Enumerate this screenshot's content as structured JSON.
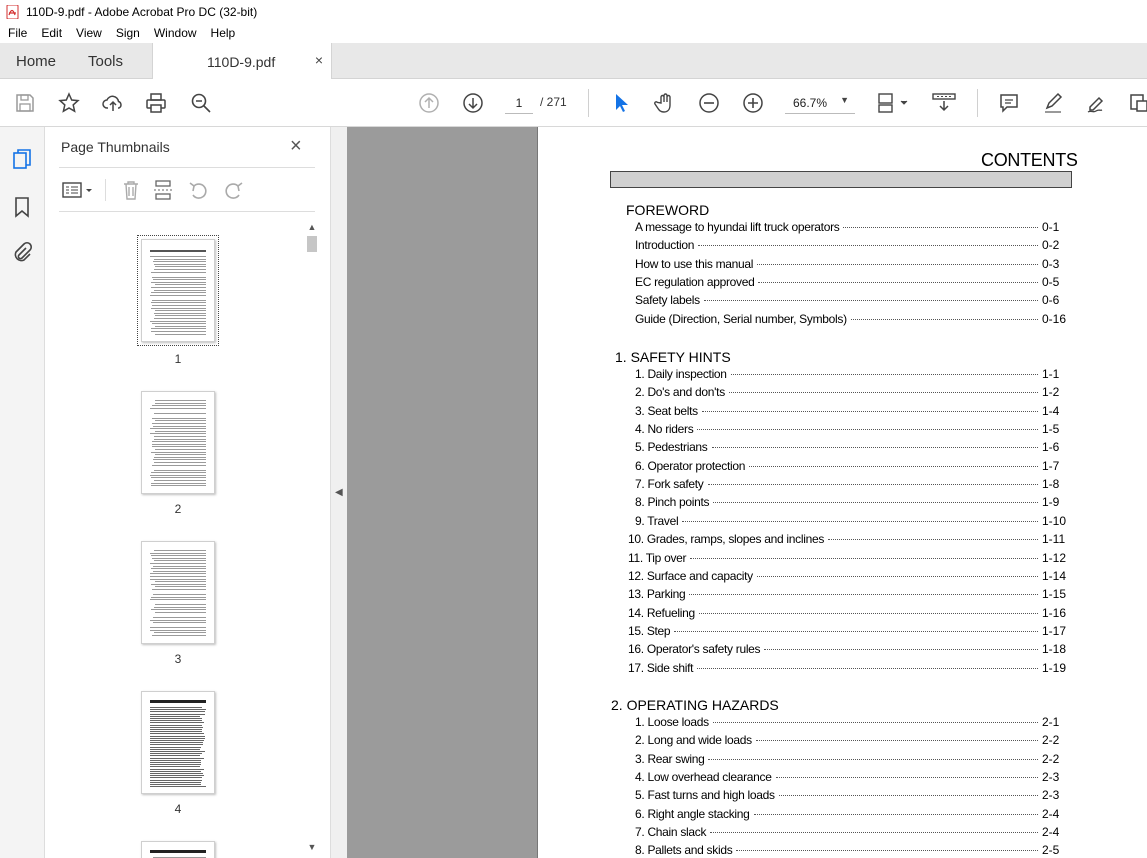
{
  "window": {
    "title": "110D-9.pdf - Adobe Acrobat Pro DC (32-bit)"
  },
  "menu": [
    "File",
    "Edit",
    "View",
    "Sign",
    "Window",
    "Help"
  ],
  "tabs": {
    "home": "Home",
    "tools": "Tools",
    "document": "110D-9.pdf",
    "close": "×"
  },
  "toolbar": {
    "current_page": "1",
    "total_pages": "/ 271",
    "zoom": "66.7%"
  },
  "thumbnails_panel": {
    "title": "Page Thumbnails",
    "close": "×",
    "pages": [
      "1",
      "2",
      "3",
      "4"
    ]
  },
  "document": {
    "contents_title": "CONTENTS",
    "sections": [
      {
        "heading": "FOREWORD",
        "entries": [
          {
            "label": "A message to hyundai lift truck operators",
            "page": "0-1"
          },
          {
            "label": "Introduction",
            "page": "0-2"
          },
          {
            "label": "How to use this manual",
            "page": "0-3"
          },
          {
            "label": "EC regulation approved",
            "page": "0-5"
          },
          {
            "label": "Safety labels",
            "page": "0-6"
          },
          {
            "label": "Guide (Direction, Serial number, Symbols)",
            "page": "0-16"
          }
        ]
      },
      {
        "heading": "1. SAFETY HINTS",
        "entries": [
          {
            "label": "1. Daily inspection",
            "page": "1-1"
          },
          {
            "label": "2. Do's and don'ts",
            "page": "1-2"
          },
          {
            "label": "3. Seat belts",
            "page": "1-4"
          },
          {
            "label": "4. No riders",
            "page": "1-5"
          },
          {
            "label": "5. Pedestrians",
            "page": "1-6"
          },
          {
            "label": "6. Operator protection",
            "page": "1-7"
          },
          {
            "label": "7.  Fork safety",
            "page": "1-8"
          },
          {
            "label": "8.  Pinch points",
            "page": "1-9"
          },
          {
            "label": "9. Travel",
            "page": "1-10"
          },
          {
            "label": "10. Grades, ramps, slopes and inclines",
            "page": "1-11"
          },
          {
            "label": "11. Tip over",
            "page": "1-12"
          },
          {
            "label": "12. Surface and capacity",
            "page": "1-14"
          },
          {
            "label": "13. Parking",
            "page": "1-15"
          },
          {
            "label": "14. Refueling",
            "page": "1-16"
          },
          {
            "label": "15. Step",
            "page": "1-17"
          },
          {
            "label": "16. Operator's safety rules",
            "page": "1-18"
          },
          {
            "label": "17. Side shift",
            "page": "1-19"
          }
        ]
      },
      {
        "heading": "2. OPERATING HAZARDS",
        "entries": [
          {
            "label": "1. Loose loads",
            "page": "2-1"
          },
          {
            "label": "2. Long and wide loads",
            "page": "2-2"
          },
          {
            "label": "3. Rear swing",
            "page": "2-2"
          },
          {
            "label": "4. Low overhead clearance",
            "page": "2-3"
          },
          {
            "label": "5. Fast turns and high loads",
            "page": "2-3"
          },
          {
            "label": "6. Right angle stacking",
            "page": "2-4"
          },
          {
            "label": "7. Chain slack",
            "page": "2-4"
          },
          {
            "label": "8. Pallets and skids",
            "page": "2-5"
          }
        ]
      }
    ]
  },
  "colors": {
    "accent_blue": "#1473e6",
    "pdf_red": "#d32f2f",
    "doc_bg": "#9b9b9b"
  },
  "icons": [
    "save-icon",
    "star-icon",
    "upload-icon",
    "print-icon",
    "search-zoom-icon",
    "page-up-icon",
    "page-down-icon",
    "select-cursor-icon",
    "hand-icon",
    "zoom-out-icon",
    "zoom-in-icon",
    "fit-page-icon",
    "scroll-mode-icon",
    "comment-icon",
    "highlight-icon",
    "sign-icon",
    "share-icon"
  ]
}
